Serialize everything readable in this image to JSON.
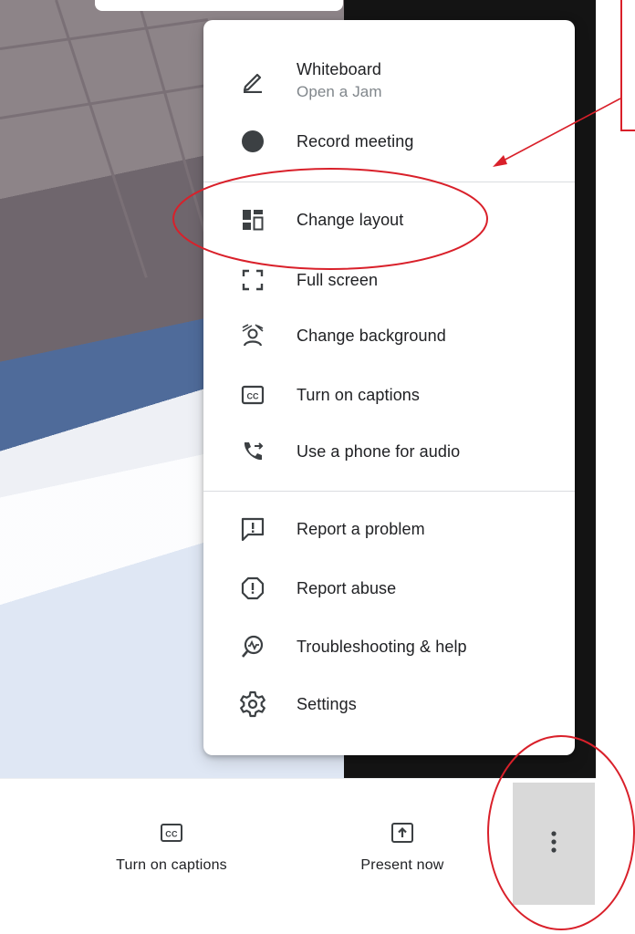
{
  "menu": {
    "items": [
      {
        "key": "whiteboard",
        "label": "Whiteboard",
        "sublabel": "Open a Jam",
        "icon": "pencil-icon"
      },
      {
        "key": "record",
        "label": "Record meeting",
        "icon": "record-dot-icon"
      },
      {
        "key": "layout",
        "label": "Change layout",
        "icon": "layout-grid-icon"
      },
      {
        "key": "fullscreen",
        "label": "Full screen",
        "icon": "fullscreen-icon"
      },
      {
        "key": "background",
        "label": "Change background",
        "icon": "background-person-icon"
      },
      {
        "key": "captions",
        "label": "Turn on captions",
        "icon": "cc-icon"
      },
      {
        "key": "phone",
        "label": "Use a phone for audio",
        "icon": "phone-transfer-icon"
      },
      {
        "key": "problem",
        "label": "Report a problem",
        "icon": "feedback-icon"
      },
      {
        "key": "abuse",
        "label": "Report abuse",
        "icon": "alert-octagon-icon"
      },
      {
        "key": "help",
        "label": "Troubleshooting & help",
        "icon": "troubleshoot-icon"
      },
      {
        "key": "settings",
        "label": "Settings",
        "icon": "gear-icon"
      }
    ]
  },
  "bottom_bar": {
    "captions_label": "Turn on captions",
    "present_label": "Present now"
  },
  "colors": {
    "annotation": "#d9202a",
    "text": "#202124",
    "subtext": "#80868b",
    "more_button_bg": "#d9d9d9"
  }
}
